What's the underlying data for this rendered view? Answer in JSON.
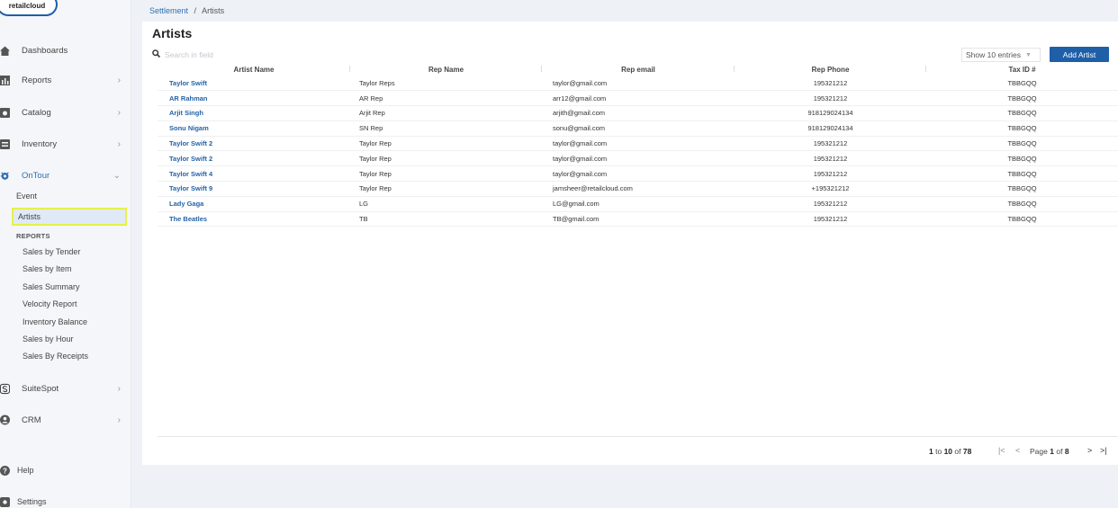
{
  "logo": {
    "text": "retailcloud"
  },
  "sidebar": {
    "items": [
      {
        "label": "Dashboards",
        "icon": "home-icon",
        "chevron": false
      },
      {
        "label": "Reports",
        "icon": "bar-chart-icon",
        "chevron": true
      },
      {
        "label": "Catalog",
        "icon": "catalog-icon",
        "chevron": true
      },
      {
        "label": "Inventory",
        "icon": "inventory-icon",
        "chevron": true
      },
      {
        "label": "OnTour",
        "icon": "ontour-icon",
        "chevron": true,
        "expanded": true
      }
    ],
    "ontour_sub": [
      {
        "label": "Event"
      },
      {
        "label": "Artists",
        "active": true
      }
    ],
    "reports_header": "REPORTS",
    "reports": [
      {
        "label": "Sales by Tender"
      },
      {
        "label": "Sales by Item"
      },
      {
        "label": "Sales Summary"
      },
      {
        "label": "Velocity Report"
      },
      {
        "label": "Inventory Balance"
      },
      {
        "label": "Sales by Hour"
      },
      {
        "label": "Sales By Receipts"
      }
    ],
    "bottom_items": [
      {
        "label": "SuiteSpot",
        "icon": "suitespot-icon",
        "chevron": true
      },
      {
        "label": "CRM",
        "icon": "crm-icon",
        "chevron": true
      }
    ],
    "footer_items": [
      {
        "label": "Help",
        "icon": "help-icon"
      },
      {
        "label": "Settings",
        "icon": "settings-icon"
      }
    ]
  },
  "breadcrumb": {
    "parent": "Settlement",
    "separator": "/",
    "current": "Artists"
  },
  "page": {
    "title": "Artists",
    "search_placeholder": "Search in field",
    "entries_label": "Show 10 entries",
    "add_button": "Add Artist"
  },
  "table": {
    "columns": [
      "Artist Name",
      "Rep Name",
      "Rep email",
      "Rep Phone",
      "Tax ID #"
    ],
    "rows": [
      [
        "Taylor Swift",
        "Taylor Reps",
        "taylor@gmail.com",
        "195321212",
        "TBBGQQ"
      ],
      [
        "AR Rahman",
        "AR Rep",
        "arr12@gmail.com",
        "195321212",
        "TBBGQQ"
      ],
      [
        "Arjit Singh",
        "Arjit Rep",
        "arjith@gmail.com",
        "918129024134",
        "TBBGQQ"
      ],
      [
        "Sonu Nigam",
        "SN Rep",
        "sonu@gmail.com",
        "918129024134",
        "TBBGQQ"
      ],
      [
        "Taylor Swift 2",
        "Taylor Rep",
        "taylor@gmail.com",
        "195321212",
        "TBBGQQ"
      ],
      [
        "Taylor Swift 2",
        "Taylor Rep",
        "taylor@gmail.com",
        "195321212",
        "TBBGQQ"
      ],
      [
        "Taylor Swift 4",
        "Taylor Rep",
        "taylor@gmail.com",
        "195321212",
        "TBBGQQ"
      ],
      [
        "Taylor Swift 9",
        "Taylor Rep",
        "jamsheer@retailcloud.com",
        "+195321212",
        "TBBGQQ"
      ],
      [
        "Lady Gaga",
        "LG",
        "LG@gmail.com",
        "195321212",
        "TBBGQQ"
      ],
      [
        "The Beatles",
        "TB",
        "TB@gmail.com",
        "195321212",
        "TBBGQQ"
      ]
    ]
  },
  "pagination": {
    "range_start": "1",
    "range_to": "to",
    "range_end": "10",
    "of": "of",
    "total": "78",
    "page_label": "Page",
    "current_page": "1",
    "total_pages": "8"
  },
  "colors": {
    "accent": "#1e5fa8",
    "link": "#2563a8",
    "highlight": "#e6f04a"
  }
}
